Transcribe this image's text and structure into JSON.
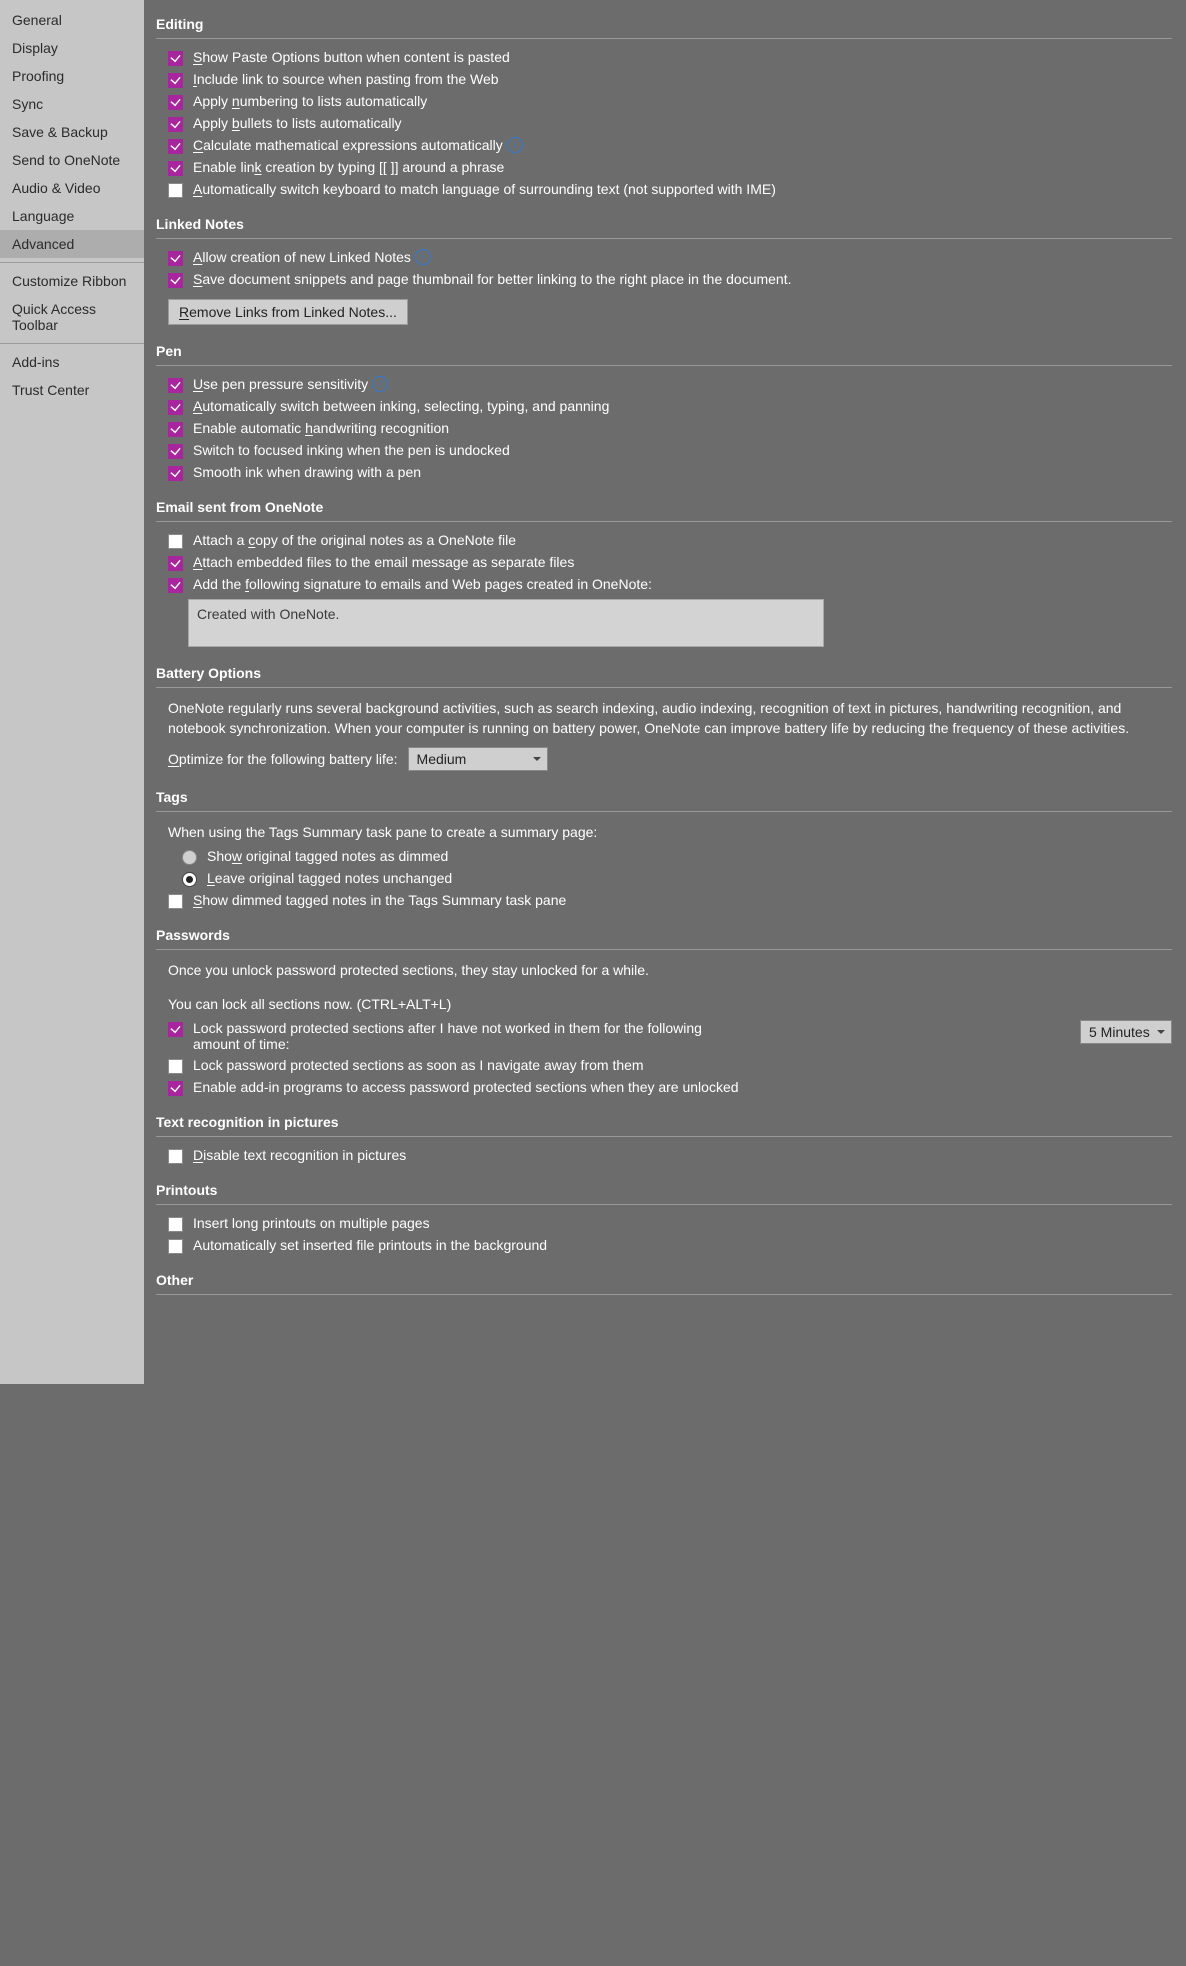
{
  "sidebar": {
    "items": [
      {
        "label": "General",
        "selected": false
      },
      {
        "label": "Display",
        "selected": false
      },
      {
        "label": "Proofing",
        "selected": false
      },
      {
        "label": "Sync",
        "selected": false
      },
      {
        "label": "Save & Backup",
        "selected": false
      },
      {
        "label": "Send to OneNote",
        "selected": false
      },
      {
        "label": "Audio & Video",
        "selected": false
      },
      {
        "label": "Language",
        "selected": false
      },
      {
        "label": "Advanced",
        "selected": true
      }
    ],
    "group2": [
      {
        "label": "Customize Ribbon"
      },
      {
        "label": "Quick Access Toolbar"
      }
    ],
    "group3": [
      {
        "label": "Add-ins"
      },
      {
        "label": "Trust Center"
      }
    ]
  },
  "sections": {
    "editing": {
      "title": "Editing",
      "opts": [
        {
          "checked": true,
          "pre": "S",
          "text": "how Paste Options button when content is pasted",
          "info": false
        },
        {
          "checked": true,
          "pre": "I",
          "text": "nclude link to source when pasting from the Web",
          "info": false
        },
        {
          "checked": true,
          "preText": "Apply ",
          "pre": "n",
          "text": "umbering to lists automatically",
          "info": false
        },
        {
          "checked": true,
          "preText": "Apply ",
          "pre": "b",
          "text": "ullets to lists automatically",
          "info": false
        },
        {
          "checked": true,
          "pre": "C",
          "text": "alculate mathematical expressions automatically",
          "info": true
        },
        {
          "checked": true,
          "preText": "Enable lin",
          "pre": "k",
          "text": " creation by typing [[  ]] around a phrase",
          "info": false
        },
        {
          "checked": false,
          "pre": "A",
          "text": "utomatically switch keyboard to match language of surrounding text (not supported with IME)",
          "info": false
        }
      ]
    },
    "linked": {
      "title": "Linked Notes",
      "opts": [
        {
          "checked": true,
          "pre": "A",
          "text": "llow creation of new Linked Notes",
          "info": true
        },
        {
          "checked": true,
          "pre": "S",
          "text": "ave document snippets and page thumbnail for better linking to the right place in the document.",
          "info": false
        }
      ],
      "button": {
        "pre": "R",
        "text": "emove Links from Linked Notes..."
      }
    },
    "pen": {
      "title": "Pen",
      "opts": [
        {
          "checked": true,
          "pre": "U",
          "text": "se pen pressure sensitivity",
          "info": true
        },
        {
          "checked": true,
          "pre": "A",
          "text": "utomatically switch between inking, selecting, typing, and panning",
          "info": false
        },
        {
          "checked": true,
          "preText": "Enable automatic ",
          "pre": "h",
          "text": "andwriting recognition",
          "info": false
        },
        {
          "checked": true,
          "preText": "Switch to focused inking when the pen is undocked",
          "noUnder": true,
          "info": false
        },
        {
          "checked": true,
          "preText": "Smooth ink when drawing with a pen",
          "noUnder": true,
          "info": false
        }
      ]
    },
    "email": {
      "title": "Email sent from OneNote",
      "opts": [
        {
          "checked": false,
          "preText": "Attach a ",
          "pre": "c",
          "text": "opy of the original notes as a OneNote file"
        },
        {
          "checked": true,
          "pre": "A",
          "text": "ttach embedded files to the email message as separate files"
        },
        {
          "checked": true,
          "preText": "Add the ",
          "pre": "f",
          "text": "ollowing signature to emails and Web pages created in OneNote:"
        }
      ],
      "signature": "Created with OneNote."
    },
    "battery": {
      "title": "Battery Options",
      "desc": "OneNote regularly runs several background activities, such as search indexing, audio indexing, recognition of text in pictures, handwriting recognition, and notebook synchronization. When your computer is running on battery power, OneNote can improve battery life by reducing the frequency of these activities.",
      "labelPre": "O",
      "labelText": "ptimize for the following battery life:",
      "value": "Medium"
    },
    "tags": {
      "title": "Tags",
      "desc": "When using the Tags Summary task pane to create a summary page:",
      "radios": [
        {
          "checked": false,
          "preText": "Sho",
          "pre": "w",
          "text": " original tagged notes as dimmed"
        },
        {
          "checked": true,
          "pre": "L",
          "text": "eave original tagged notes unchanged"
        }
      ],
      "check": {
        "checked": false,
        "pre": "S",
        "text": "how dimmed tagged notes in the Tags Summary task pane"
      }
    },
    "passwords": {
      "title": "Passwords",
      "desc1": "Once you unlock password protected sections, they stay unlocked for a while.",
      "desc2": "You can lock all sections now. (CTRL+ALT+L)",
      "opts": [
        {
          "checked": true,
          "preText": "Lock password protected sections after I have not worked in them for the following amount of time:",
          "noUnder": true,
          "hasSelect": true
        },
        {
          "checked": false,
          "preText": "Lock password protected sections as soon as I navigate away from them",
          "noUnder": true
        },
        {
          "checked": true,
          "preText": "Enable add-in programs to access password protected sections when they are unlocked",
          "noUnder": true
        }
      ],
      "lockValue": "5 Minutes"
    },
    "textrec": {
      "title": "Text recognition in pictures",
      "opts": [
        {
          "checked": false,
          "pre": "D",
          "text": "isable text recognition in pictures"
        }
      ]
    },
    "printouts": {
      "title": "Printouts",
      "opts": [
        {
          "checked": false,
          "preText": "Insert long printouts on multiple pages",
          "noUnder": true
        },
        {
          "checked": false,
          "preText": "Automatically set inserted file printouts in the background",
          "noUnder": true
        }
      ]
    },
    "other": {
      "title": "Other"
    }
  }
}
